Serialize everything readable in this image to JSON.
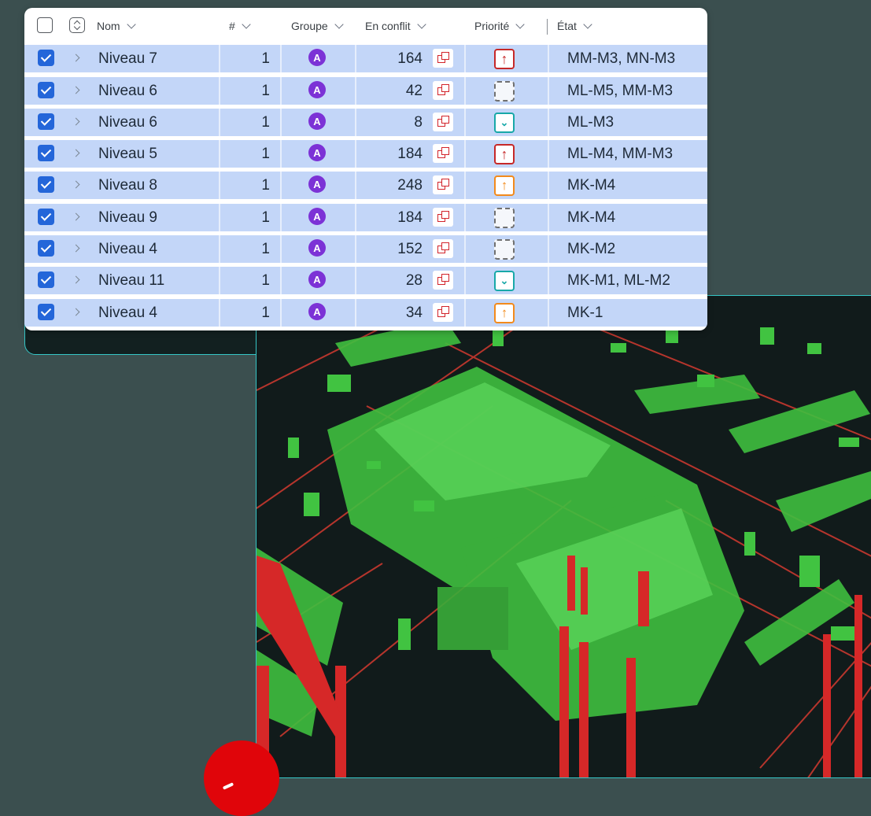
{
  "table": {
    "header": {
      "name": "Nom",
      "count": "#",
      "group": "Groupe",
      "conflict": "En conflit",
      "priority": "Priorité",
      "state": "État"
    },
    "rows": [
      {
        "name": "Niveau 7",
        "count": "1",
        "group": "A",
        "conflicts": "164",
        "priority": "high",
        "state": "MM-M3, MN-M3",
        "checked": true
      },
      {
        "name": "Niveau 6",
        "count": "1",
        "group": "A",
        "conflicts": "42",
        "priority": "none",
        "state": "ML-M5, MM-M3",
        "checked": true
      },
      {
        "name": "Niveau 6",
        "count": "1",
        "group": "A",
        "conflicts": "8",
        "priority": "low",
        "state": "ML-M3",
        "checked": true
      },
      {
        "name": "Niveau 5",
        "count": "1",
        "group": "A",
        "conflicts": "184",
        "priority": "high",
        "state": "ML-M4, MM-M3",
        "checked": true
      },
      {
        "name": "Niveau 8",
        "count": "1",
        "group": "A",
        "conflicts": "248",
        "priority": "medium",
        "state": "MK-M4",
        "checked": true
      },
      {
        "name": "Niveau 9",
        "count": "1",
        "group": "A",
        "conflicts": "184",
        "priority": "none",
        "state": "MK-M4",
        "checked": true
      },
      {
        "name": "Niveau 4",
        "count": "1",
        "group": "A",
        "conflicts": "152",
        "priority": "none",
        "state": "MK-M2",
        "checked": true
      },
      {
        "name": "Niveau 11",
        "count": "1",
        "group": "A",
        "conflicts": "28",
        "priority": "low",
        "state": "MK-M1, ML-M2",
        "checked": true
      },
      {
        "name": "Niveau 4",
        "count": "1",
        "group": "A",
        "conflicts": "34",
        "priority": "medium",
        "state": "MK-1",
        "checked": true
      }
    ]
  },
  "icons": {
    "select_all": "checkbox-icon",
    "sort": "sort-icon",
    "expand": "chevron-right-icon",
    "group": "avatar-icon",
    "conflict": "overlap-icon",
    "priority_high": "arrow-up-icon",
    "priority_medium": "arrow-up-icon",
    "priority_low": "chevron-down-icon",
    "priority_none": "empty-square-icon"
  },
  "colors": {
    "row_bg": "#c3d6f8",
    "checkbox": "#2466d9",
    "group_avatar": "#7c32d6",
    "conflict": "#d2232a",
    "priority_high": "#c62828",
    "priority_medium": "#f28a1c",
    "priority_low": "#18a8a8",
    "viewport_border": "#35c6c6",
    "background": "#3b4f4f"
  }
}
